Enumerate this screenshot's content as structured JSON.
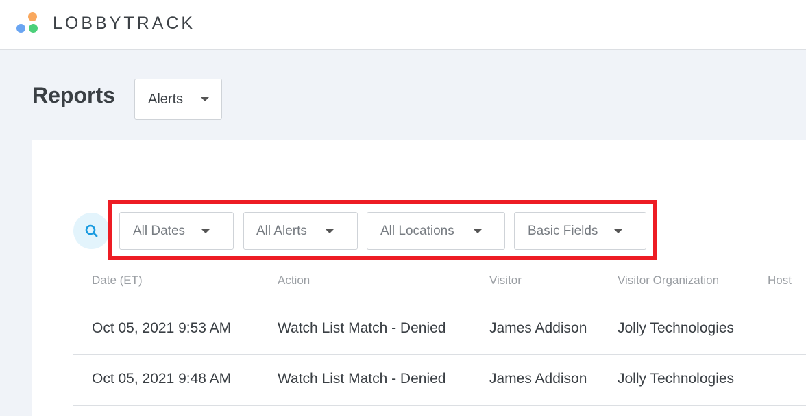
{
  "brand": {
    "name": "LOBBYTRACK",
    "colors": [
      "#f9a85e",
      "#6aa5f2",
      "#4cd07a"
    ]
  },
  "page": {
    "title": "Reports",
    "report_type": "Alerts"
  },
  "filters": [
    {
      "label": "All Dates"
    },
    {
      "label": "All Alerts"
    },
    {
      "label": "All Locations"
    },
    {
      "label": "Basic Fields"
    }
  ],
  "highlight_color": "#ed1c24",
  "table": {
    "columns": [
      "Date (ET)",
      "Action",
      "Visitor",
      "Visitor Organization",
      "Host"
    ],
    "rows": [
      [
        "Oct 05, 2021 9:53 AM",
        "Watch List Match - Denied",
        "James Addison",
        "Jolly Technologies"
      ],
      [
        "Oct 05, 2021 9:48 AM",
        "Watch List Match - Denied",
        "James Addison",
        "Jolly Technologies"
      ]
    ]
  }
}
